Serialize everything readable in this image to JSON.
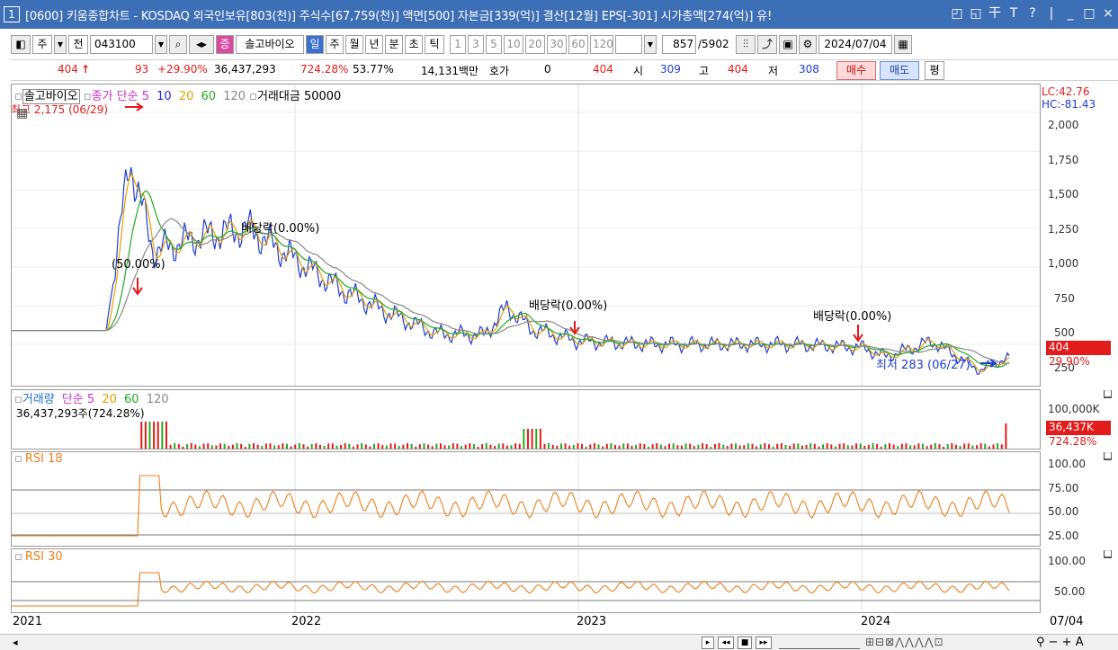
{
  "window": {
    "number": "1",
    "title": "[0600] 키움종합차트 - KOSDAQ 외국인보유[803(천)] 주식수[67,759(천)] 액면[500] 자본금[339(억)] 결산[12월] EPS[-301] 시가총액[274(억)] 유!",
    "buttons": [
      "◰",
      "◱",
      "干",
      "T",
      "?",
      "|",
      "_",
      "□",
      "×"
    ]
  },
  "toolbar": {
    "period_label": "주",
    "prev_label": "전",
    "code": "043100",
    "search_icon": "magnifier-icon",
    "sound_icon": "speaker-icon",
    "market_badge": "증",
    "stock_name": "솔고바이오",
    "periods": [
      "일",
      "주",
      "월",
      "년",
      "분",
      "초",
      "틱"
    ],
    "active_period": "일",
    "intervals": [
      "1",
      "3",
      "5",
      "10",
      "20",
      "30",
      "60",
      "120"
    ],
    "page_current": "857",
    "page_total": "/5902",
    "date": "2024/07/04"
  },
  "quote": {
    "price": "404",
    "arrow": "↑",
    "change": "93",
    "change_pct": "+29.90%",
    "volume": "36,437,293",
    "volume_ratio": "724.28%",
    "turnover": "53.77%",
    "amount": "14,131백만",
    "hoga_label": "호가",
    "hoga_value": "0",
    "hoga_price": "404",
    "open_label": "시",
    "open": "309",
    "high_label": "고",
    "high": "404",
    "low_label": "저",
    "low": "308",
    "buy_label": "매수",
    "sell_label": "매도",
    "eval_label": "평"
  },
  "price_panel": {
    "legend_name": "솔고바이오",
    "legend_ma": "종가 단순",
    "ma_periods": [
      {
        "v": "5",
        "color": "#cc33cc"
      },
      {
        "v": "10",
        "color": "#2222ee"
      },
      {
        "v": "20",
        "color": "#e8a000"
      },
      {
        "v": "60",
        "color": "#22aa22"
      },
      {
        "v": "120",
        "color": "#888888"
      }
    ],
    "legend_amount": "거래대금 50000",
    "lc": "LC:42.76",
    "hc": "HC:-81.43",
    "annot_high": "최고 2,175 (06/29)",
    "annot_low": "최저 283 (06/27)",
    "annot_div1": "배당락(0.00%)",
    "annot_div2": "배당락(0.00%)",
    "annot_div3": "배당락(0.00%)",
    "annot_split": "(50.00%)",
    "y_ticks": [
      "2,000",
      "1,750",
      "1,500",
      "1,250",
      "1,000",
      "750",
      "500",
      "250"
    ],
    "last_price": "404",
    "last_change": "29.90%"
  },
  "volume_panel": {
    "legend": "거래량",
    "legend_ma": "단순",
    "ma_periods": [
      {
        "v": "5",
        "color": "#cc33cc"
      },
      {
        "v": "20",
        "color": "#e8a000"
      },
      {
        "v": "60",
        "color": "#22aa22"
      },
      {
        "v": "120",
        "color": "#888888"
      }
    ],
    "current": "36,437,293주(724.28%)",
    "y_tick": "100,000K",
    "badge_value": "36,437K",
    "badge_pct": "724.28%"
  },
  "rsi18": {
    "label": "RSI 18",
    "y_ticks": [
      "100.00",
      "75.00",
      "50.00",
      "25.00"
    ]
  },
  "rsi30": {
    "label": "RSI 30",
    "y_ticks": [
      "100.00",
      "50.00"
    ]
  },
  "x_axis": {
    "labels": [
      "2021",
      "2022",
      "2023",
      "2024"
    ],
    "right_label": "07/04"
  },
  "colors": {
    "up": "#e41b1b",
    "down": "#1f3fd0",
    "ma5": "#cc33cc",
    "ma10": "#2222ee",
    "ma20": "#e8a000",
    "ma60": "#22aa22",
    "ma120": "#888888",
    "rsi": "#ef7f1a"
  },
  "chart_data": {
    "type": "line",
    "title": "",
    "xlabel": "",
    "ylabel": "",
    "ylim": [
      250,
      2175
    ],
    "series": [
      {
        "name": "종가",
        "x": [
          "2021-01",
          "2021-05",
          "2021-06",
          "2021-07",
          "2021-09",
          "2021-11",
          "2022-01",
          "2022-03",
          "2022-05",
          "2022-07",
          "2022-09",
          "2022-10",
          "2022-11",
          "2023-01",
          "2023-04",
          "2023-07",
          "2023-10",
          "2024-01",
          "2024-02",
          "2024-04",
          "2024-06",
          "2024-07"
        ],
        "y": [
          590,
          590,
          1700,
          1100,
          1200,
          1250,
          1050,
          850,
          700,
          570,
          560,
          740,
          600,
          520,
          500,
          500,
          500,
          480,
          420,
          520,
          330,
          404
        ]
      }
    ]
  }
}
